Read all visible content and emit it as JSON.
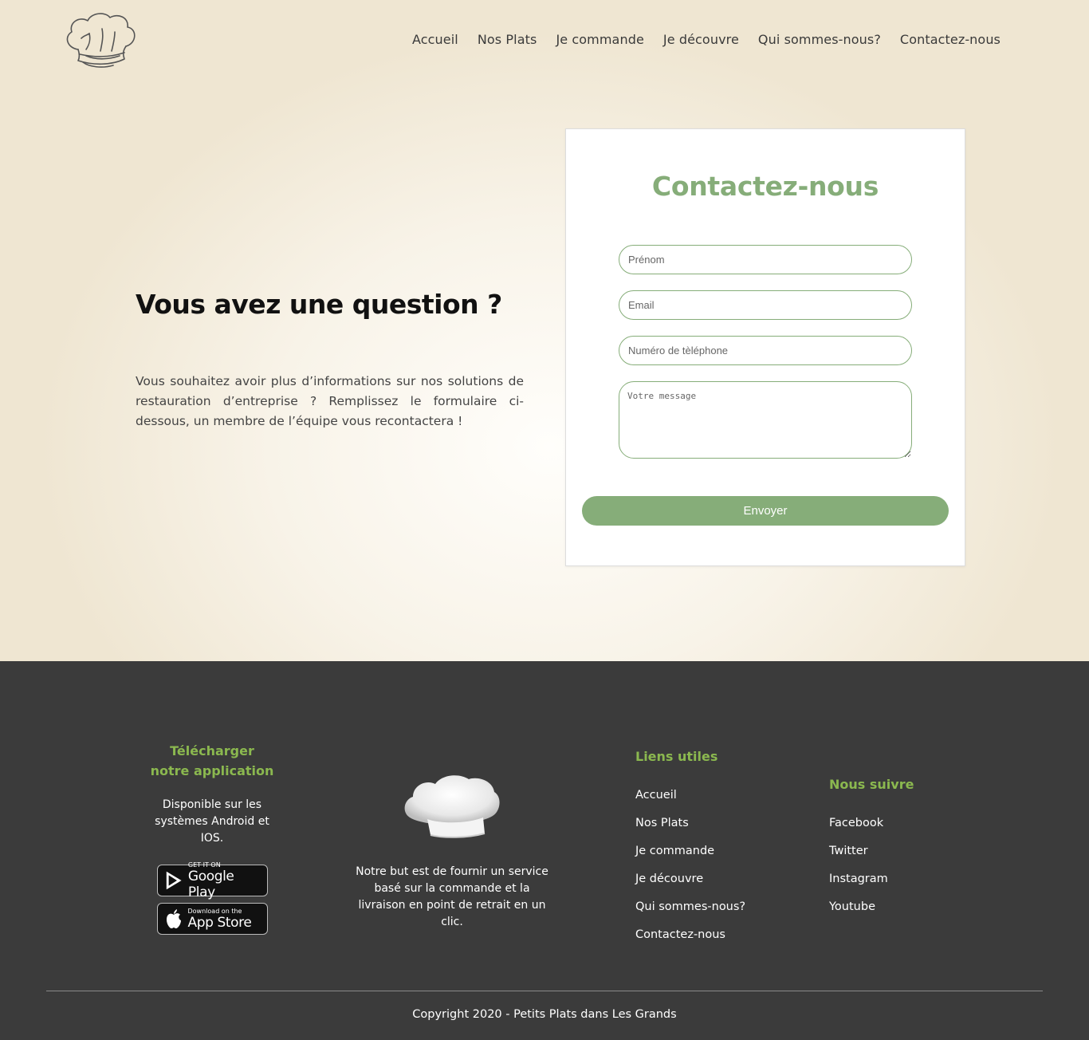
{
  "header": {
    "logo_icon": "chef-hat-icon",
    "nav": [
      "Accueil",
      "Nos Plats",
      "Je commande",
      "Je découvre",
      "Qui sommes-nous?",
      "Contactez-nous"
    ]
  },
  "hero": {
    "title": "Vous avez une question ?",
    "text": "Vous souhaitez avoir plus d’informations sur nos solutions de restauration d’entreprise ? Remplissez le formulaire ci-dessous, un membre de l’équipe vous recontactera !"
  },
  "form": {
    "title": "Contactez-nous",
    "firstname_placeholder": "Prénom",
    "email_placeholder": "Email",
    "phone_placeholder": "Numéro de tèléphone",
    "message_placeholder": "Votre message",
    "submit_label": "Envoyer"
  },
  "footer": {
    "app": {
      "title": "Télécharger notre application",
      "desc": "Disponible sur les systèmes Android et IOS.",
      "google_small": "GET IT ON",
      "google_big": "Google Play",
      "apple_small": "Download on the",
      "apple_big": "App Store"
    },
    "mission": "Notre but est de fournir un service basé sur la commande et la livraison en point de retrait en un clic.",
    "links": {
      "title": "Liens utiles",
      "items": [
        "Accueil",
        "Nos Plats",
        "Je commande",
        "Je découvre",
        "Qui sommes-nous?",
        "Contactez-nous"
      ]
    },
    "follow": {
      "title": "Nous suivre",
      "items": [
        "Facebook",
        "Twitter",
        "Instagram",
        "Youtube"
      ]
    },
    "copyright": "Copyright 2020 - Petits Plats dans Les Grands"
  },
  "colors": {
    "accent": "#86ad79",
    "footer_green": "#8bb84f",
    "footer_bg": "#3b3b3b"
  }
}
